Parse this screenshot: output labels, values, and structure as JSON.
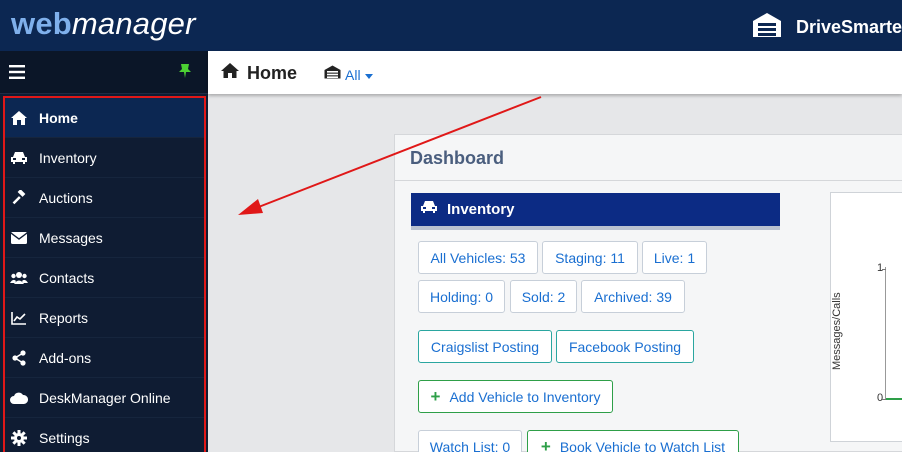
{
  "app": {
    "logo_part1": "web",
    "logo_part2": "manager",
    "brand": "DriveSmarter"
  },
  "sidebar": {
    "items": [
      {
        "label": "Home",
        "icon": "home-icon"
      },
      {
        "label": "Inventory",
        "icon": "car-icon"
      },
      {
        "label": "Auctions",
        "icon": "gavel-icon"
      },
      {
        "label": "Messages",
        "icon": "envelope-icon"
      },
      {
        "label": "Contacts",
        "icon": "users-icon"
      },
      {
        "label": "Reports",
        "icon": "line-chart-icon"
      },
      {
        "label": "Add-ons",
        "icon": "share-icon"
      },
      {
        "label": "DeskManager Online",
        "icon": "cloud-icon"
      },
      {
        "label": "Settings",
        "icon": "gear-icon"
      }
    ]
  },
  "header": {
    "title": "Home",
    "location_filter": "All"
  },
  "dashboard": {
    "title": "Dashboard",
    "inventory": {
      "title": "Inventory",
      "counts": {
        "all_vehicles": "All Vehicles: 53",
        "staging": "Staging: 11",
        "live": "Live: 1",
        "holding": "Holding: 0",
        "sold": "Sold: 2",
        "archived": "Archived: 39"
      },
      "craigslist": "Craigslist Posting",
      "facebook": "Facebook Posting",
      "add_vehicle": "Add Vehicle to Inventory",
      "watch_list": "Watch List: 0",
      "book_vehicle": "Book Vehicle to Watch List"
    },
    "chart": {
      "ylabel": "Messages/Calls",
      "y_ticks": [
        "1",
        "0"
      ]
    }
  },
  "colors": {
    "topbar": "#0c2752",
    "sidebar": "#0f1c33",
    "accent_blue": "#1a6fd1",
    "inventory_header": "#0c2b84",
    "highlight_red": "#e01818"
  }
}
